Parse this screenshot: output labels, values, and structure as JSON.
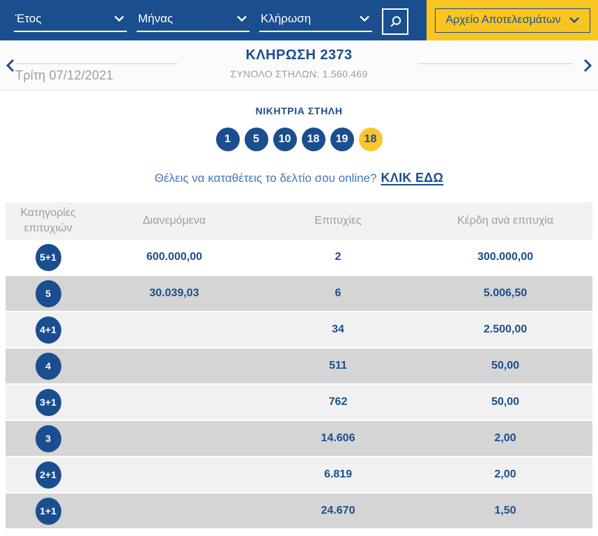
{
  "colors": {
    "primary_blue": "#1B4E8F",
    "banner_yellow": "#F8C521",
    "joker_yellow": "#FDC52F",
    "row_gray": "#D4D5D4",
    "row_light": "#F1F1F1",
    "muted_text": "#9D9D9D"
  },
  "topbar": {
    "filters": [
      {
        "label": "Έτος"
      },
      {
        "label": "Μήνας"
      },
      {
        "label": "Κλήρωση"
      }
    ],
    "archive_button_label": "Αρχείο Αποτελεσμάτων"
  },
  "draw_header": {
    "title": "ΚΛΗΡΩΣΗ 2373",
    "date": "Τρίτη 07/12/2021",
    "total_columns": "ΣΥΝΟΛΟ ΣΤΗΛΩΝ: 1.560.469"
  },
  "winning": {
    "heading": "ΝΙΚΗΤΡΙΑ ΣΤΗΛΗ",
    "numbers": [
      "1",
      "5",
      "10",
      "18",
      "19"
    ],
    "joker": "18",
    "cta_text": "Θέλεις να καταθέτεις το δελτίο σου online?",
    "cta_link": "ΚΛΙΚ ΕΔΩ"
  },
  "table": {
    "headers": [
      "Κατηγορίες επιτυχιών",
      "Διανεμόμενα",
      "Επιτυχίες",
      "Κέρδη ανά επιτυχία"
    ],
    "rows": [
      {
        "category": "5+1",
        "distributed": "600.000,00",
        "winners": "2",
        "payout": "300.000,00"
      },
      {
        "category": "5",
        "distributed": "30.039,03",
        "winners": "6",
        "payout": "5.006,50"
      },
      {
        "category": "4+1",
        "distributed": "",
        "winners": "34",
        "payout": "2.500,00"
      },
      {
        "category": "4",
        "distributed": "",
        "winners": "511",
        "payout": "50,00"
      },
      {
        "category": "3+1",
        "distributed": "",
        "winners": "762",
        "payout": "50,00"
      },
      {
        "category": "3",
        "distributed": "",
        "winners": "14.606",
        "payout": "2,00"
      },
      {
        "category": "2+1",
        "distributed": "",
        "winners": "6.819",
        "payout": "2,00"
      },
      {
        "category": "1+1",
        "distributed": "",
        "winners": "24.670",
        "payout": "1,50"
      }
    ]
  }
}
